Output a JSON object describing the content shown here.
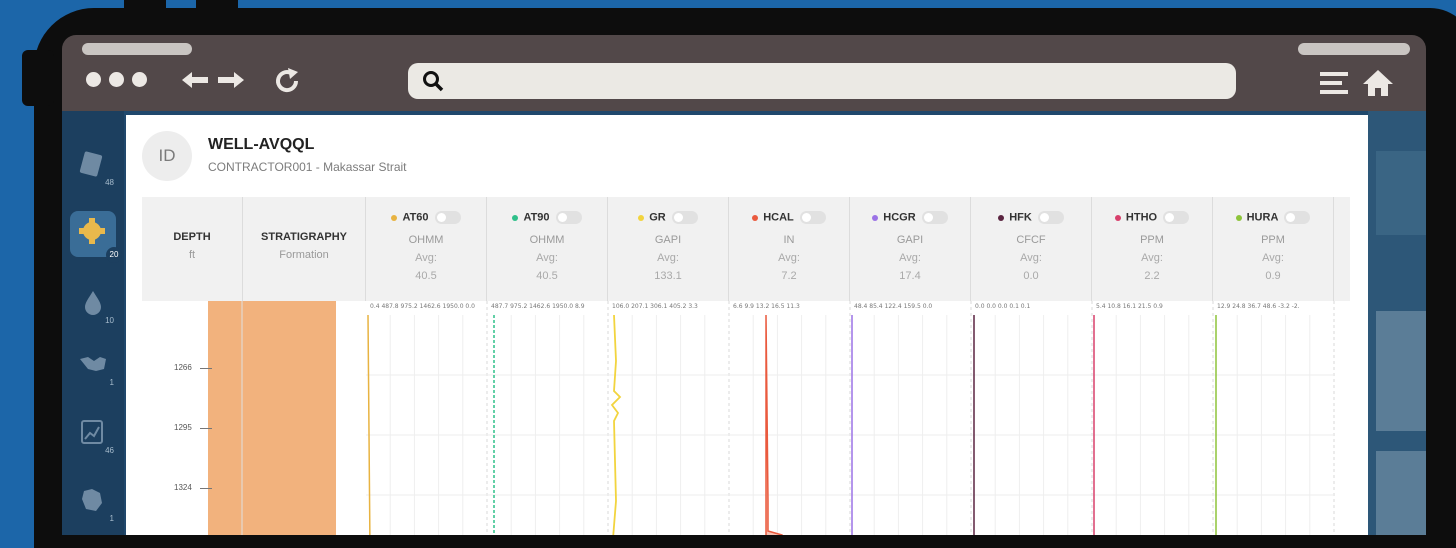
{
  "well": {
    "avatar_text": "ID",
    "name": "WELL-AVQQL",
    "subtitle": "CONTRACTOR001 - Makassar Strait"
  },
  "browser": {
    "url": "",
    "icons": [
      "window-dots",
      "back-arrow-icon",
      "forward-arrow-icon",
      "refresh-icon",
      "search-icon",
      "menu-icon",
      "home-icon"
    ]
  },
  "sidebar": {
    "items": [
      {
        "icon": "document-icon",
        "count": "48"
      },
      {
        "icon": "gear-icon",
        "count": "20",
        "active": true
      },
      {
        "icon": "droplet-icon",
        "count": "10"
      },
      {
        "icon": "handshake-icon",
        "count": "1"
      },
      {
        "icon": "chart-document-icon",
        "count": "46"
      },
      {
        "icon": "map-icon",
        "count": "1"
      }
    ]
  },
  "log_header": {
    "depth": {
      "name": "DEPTH",
      "unit": "ft"
    },
    "stratigraphy": {
      "name": "STRATIGRAPHY",
      "unit": "Formation"
    },
    "avg_label": "Avg:",
    "curves": [
      {
        "name": "AT60",
        "unit": "OHMM",
        "avg": "40.5",
        "color": "#e8b341",
        "scale": "0.4   487.8  975.2 1462.6 1950.0  0.0"
      },
      {
        "name": "AT90",
        "unit": "OHMM",
        "avg": "40.5",
        "color": "#2fc08a",
        "scale": "487.7  975.2 1462.6 1950.0  8.9"
      },
      {
        "name": "GR",
        "unit": "GAPI",
        "avg": "133.1",
        "color": "#f2d43e",
        "scale": "106.0  207.1  306.1  405.2  3.3"
      },
      {
        "name": "HCAL",
        "unit": "IN",
        "avg": "7.2",
        "color": "#ea5a3e",
        "scale": "6.6   9.9   13.2   16.5  11.3"
      },
      {
        "name": "HCGR",
        "unit": "GAPI",
        "avg": "17.4",
        "color": "#9b72e6",
        "scale": "48.4  85.4  122.4  159.5  0.0"
      },
      {
        "name": "HFK",
        "unit": "CFCF",
        "avg": "0.0",
        "color": "#5a2440",
        "scale": "0.0   0.0   0.0   0.1   0.1"
      },
      {
        "name": "HTHO",
        "unit": "PPM",
        "avg": "2.2",
        "color": "#d8406c",
        "scale": "5.4  10.8  16.1  21.5  0.9"
      },
      {
        "name": "HURA",
        "unit": "PPM",
        "avg": "0.9",
        "color": "#8dc43a",
        "scale": "12.9  24.8  36.7  48.6  -3.2  -2."
      }
    ]
  },
  "depth_track": {
    "labels": [
      "1266",
      "1295",
      "1324"
    ]
  },
  "stratigraphy_fill_color": "#f2b27d"
}
